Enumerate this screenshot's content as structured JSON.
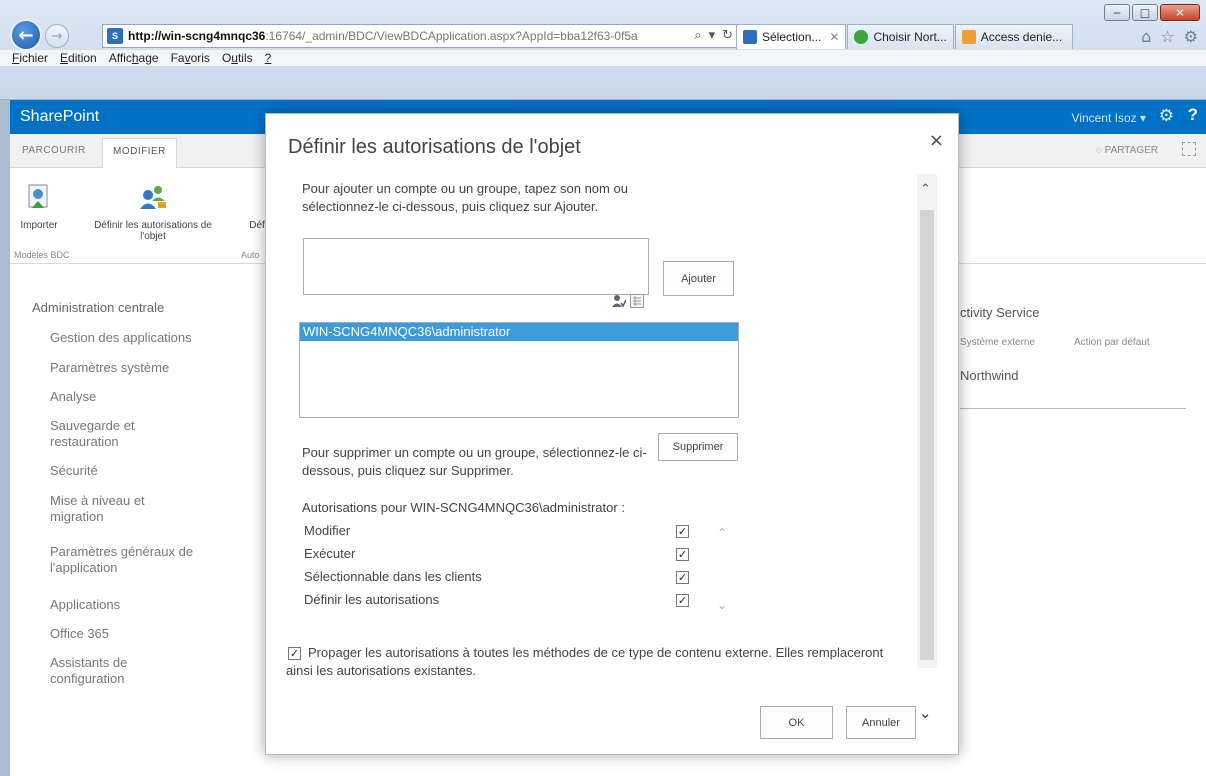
{
  "window": {
    "minimize_glyph": "−",
    "maximize_glyph": "□",
    "close_glyph": "✕"
  },
  "browser": {
    "back_glyph": "←",
    "forward_glyph": "→",
    "address_favicon": "S",
    "address_host": "http://win-scng4mnqc36",
    "address_path": ":16764/_admin/BDC/ViewBDCApplication.aspx?AppId=bba12f63-0f5a",
    "address_tools": [
      "⌕",
      "▾",
      "↻"
    ],
    "tabs": [
      {
        "label": "Sélection...",
        "close": "✕",
        "icon_color": "#2e6fbd",
        "active": true
      },
      {
        "label": "Choisir Nort...",
        "close": "",
        "icon_color": "#3aa53a",
        "active": false
      },
      {
        "label": "Access denie...",
        "close": "",
        "icon_color": "#f0a030",
        "active": false
      }
    ],
    "right_tools": [
      "⌂",
      "☆",
      "⚙"
    ],
    "menu": [
      {
        "pre": "",
        "key": "F",
        "post": "ichier"
      },
      {
        "pre": "",
        "key": "E",
        "post": "dition"
      },
      {
        "pre": "Affic",
        "key": "h",
        "post": "age"
      },
      {
        "pre": "Fa",
        "key": "v",
        "post": "oris"
      },
      {
        "pre": "O",
        "key": "u",
        "post": "tils"
      },
      {
        "pre": "",
        "key": "?",
        "post": ""
      }
    ]
  },
  "sharepoint": {
    "brand": "SharePoint",
    "user": "Vincent Isoz ▾",
    "gear_glyph": "⚙",
    "help_glyph": "?",
    "ribbon_tabs": [
      "PARCOURIR",
      "MODIFIER"
    ],
    "share_label": "PARTAGER",
    "ribbon_buttons": {
      "import": "Importer",
      "define_perms": "Définir les autorisations de l'objet",
      "def_partial": "Déf"
    },
    "groups": {
      "models": "Modèles BDC",
      "auto_partial": "Auto"
    },
    "leftnav": [
      "Administration centrale",
      "Gestion des applications",
      "Paramètres système",
      "Analyse",
      "Sauvegarde et restauration",
      "Sécurité",
      "Mise à niveau et migration",
      "Paramètres généraux de l'application",
      "Applications",
      "Office 365",
      "Assistants de configuration"
    ],
    "background_right": {
      "service_title": "ctivity Service",
      "col_system": "Système externe",
      "col_action": "Action par défaut",
      "value": "Northwind"
    }
  },
  "dialog": {
    "title": "Définir les autorisations de l'objet",
    "close": "×",
    "add_instructions": "Pour ajouter un compte ou un groupe, tapez son nom ou sélectionnez-le ci-dessous, puis cliquez sur Ajouter.",
    "add_input_value": "",
    "add_button": "Ajouter",
    "accounts": [
      "WIN-SCNG4MNQC36\\administrator"
    ],
    "remove_instructions": "Pour supprimer un compte ou un groupe, sélectionnez-le ci-dessous, puis cliquez sur Supprimer.",
    "remove_button": "Supprimer",
    "permissions_heading": "Autorisations pour WIN-SCNG4MNQC36\\administrator :",
    "permissions": [
      {
        "label": "Modifier",
        "checked": true
      },
      {
        "label": "Exécuter",
        "checked": true
      },
      {
        "label": "Sélectionnable dans les clients",
        "checked": true
      },
      {
        "label": "Définir les autorisations",
        "checked": true
      }
    ],
    "propagate_checked": true,
    "propagate_text": "Propager les autorisations à toutes les méthodes de ce type de contenu externe. Elles remplaceront ainsi les autorisations existantes.",
    "ok_button": "OK",
    "cancel_button": "Annuler",
    "check_glyph": "✓",
    "scroll_up": "⌃",
    "scroll_down": "⌄"
  }
}
